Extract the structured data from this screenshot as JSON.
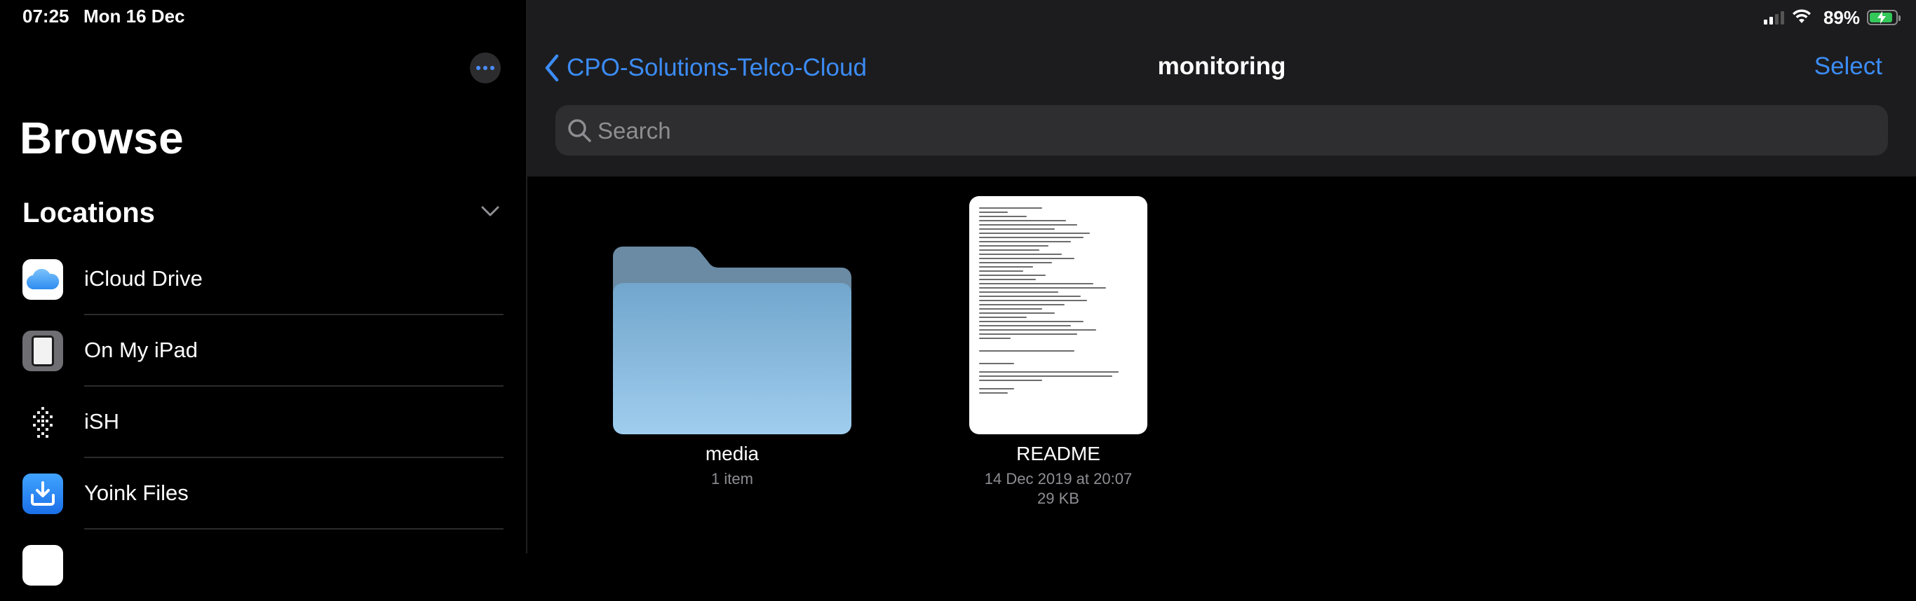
{
  "status_bar": {
    "time": "07:25",
    "date": "Mon 16 Dec",
    "battery_percent": "89%",
    "battery_level": 0.89,
    "wifi_icon": "wifi-icon",
    "signal_icon": "cellular-signal-icon"
  },
  "sidebar": {
    "title": "Browse",
    "section_title": "Locations",
    "more_icon": "ellipsis-icon",
    "items": [
      {
        "label": "iCloud Drive",
        "icon": "icloud-icon"
      },
      {
        "label": "On My iPad",
        "icon": "ipad-icon"
      },
      {
        "label": "iSH",
        "icon": "ish-icon"
      },
      {
        "label": "Yoink Files",
        "icon": "yoink-icon"
      }
    ]
  },
  "nav": {
    "back_label": "CPO-Solutions-Telco-Cloud",
    "title": "monitoring",
    "select_label": "Select"
  },
  "search": {
    "placeholder": "Search"
  },
  "files": [
    {
      "name": "media",
      "meta": "1 item",
      "type": "folder"
    },
    {
      "name": "README",
      "meta_date": "14 Dec 2019 at 20:07",
      "meta_size": "29 KB",
      "type": "document"
    }
  ],
  "colors": {
    "accent": "#3c8cf5",
    "background": "#000000",
    "navbar": "#1c1c1e",
    "folder": "#8fc3e6",
    "battery": "#34c759"
  }
}
